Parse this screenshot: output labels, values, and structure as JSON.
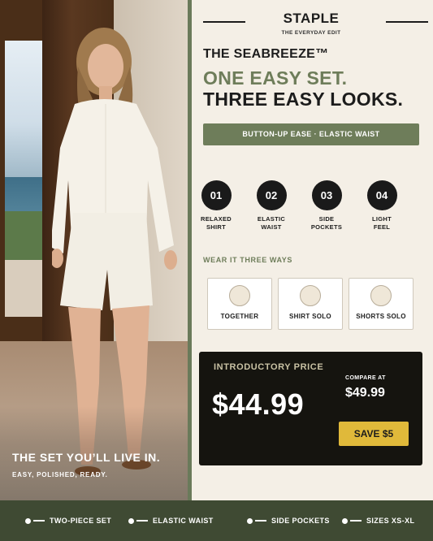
{
  "brand": {
    "name": "STAPLE",
    "subtitle": "THE EVERYDAY EDIT"
  },
  "product": {
    "name": "THE SEABREEZE™",
    "headline_line1": "ONE EASY SET.",
    "headline_line2": "THREE EASY LOOKS."
  },
  "banner": {
    "text": "BUTTON-UP EASE · ELASTIC WAIST"
  },
  "features": [
    {
      "num": "01",
      "label_line1": "RELAXED",
      "label_line2": "SHIRT"
    },
    {
      "num": "02",
      "label_line1": "ELASTIC",
      "label_line2": "WAIST"
    },
    {
      "num": "03",
      "label_line1": "SIDE",
      "label_line2": "POCKETS"
    },
    {
      "num": "04",
      "label_line1": "LIGHT",
      "label_line2": "FEEL"
    }
  ],
  "ways": {
    "title": "WEAR IT THREE WAYS",
    "options": [
      {
        "label": "TOGETHER"
      },
      {
        "label": "SHIRT SOLO"
      },
      {
        "label": "SHORTS SOLO"
      }
    ]
  },
  "pricing": {
    "intro_label": "INTRODUCTORY PRICE",
    "price": "$44.99",
    "compare_label": "COMPARE AT",
    "compare_price": "$49.99",
    "save_label": "SAVE $5"
  },
  "photo": {
    "tagline": "THE SET YOU’LL LIVE IN.",
    "subtagline": "EASY, POLISHED, READY."
  },
  "footer": {
    "items": [
      "TWO-PIECE SET",
      "ELASTIC WAIST",
      "SIDE POCKETS",
      "SIZES XS-XL"
    ]
  },
  "colors": {
    "sage": "#6e7d5a",
    "dark": "#15140f",
    "gold": "#e0b93a",
    "cream": "#f4efe6",
    "footer": "#3f4a33"
  }
}
